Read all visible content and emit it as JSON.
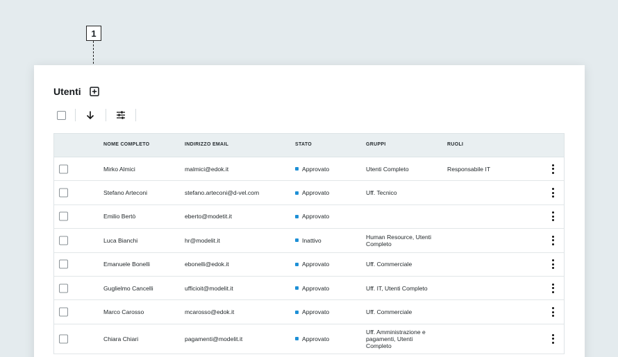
{
  "callout": {
    "label": "1"
  },
  "page": {
    "title": "Utenti"
  },
  "icons": {
    "add": "plus-square-icon",
    "sort": "arrow-down-icon",
    "filter": "sliders-icon",
    "row_menu": "more-vertical-icon"
  },
  "colors": {
    "status_dot": "#1e90d6",
    "header_bg": "#e9eff1"
  },
  "table": {
    "columns": [
      "NOME COMPLETO",
      "INDIRIZZO EMAIL",
      "STATO",
      "GRUPPI",
      "RUOLI"
    ],
    "rows": [
      {
        "name": "Mirko Almici",
        "email": "malmici@edok.it",
        "status": "Approvato",
        "groups": "Utenti Completo",
        "roles": "Responsabile IT"
      },
      {
        "name": "Stefano Arteconi",
        "email": "stefano.arteconi@d-vel.com",
        "status": "Approvato",
        "groups": "Uff. Tecnico",
        "roles": ""
      },
      {
        "name": "Emilio Bertò",
        "email": "eberto@modetit.it",
        "status": "Approvato",
        "groups": "",
        "roles": ""
      },
      {
        "name": "Luca Bianchi",
        "email": "hr@modelit.it",
        "status": "Inattivo",
        "groups": "Human Resource, Utenti Completo",
        "roles": ""
      },
      {
        "name": "Emanuele Bonelli",
        "email": "ebonelli@edok.it",
        "status": "Approvato",
        "groups": "Uff. Commerciale",
        "roles": ""
      },
      {
        "name": "Guglielmo Cancelli",
        "email": "ufficioit@modelit.it",
        "status": "Approvato",
        "groups": "Uff. IT, Utenti Completo",
        "roles": ""
      },
      {
        "name": "Marco Carosso",
        "email": "mcarosso@edok.it",
        "status": "Approvato",
        "groups": "Uff. Commerciale",
        "roles": ""
      },
      {
        "name": "Chiara Chiari",
        "email": "pagamenti@modelit.it",
        "status": "Approvato",
        "groups": "Uff. Amministrazione e pagamenti, Utenti Completo",
        "roles": ""
      }
    ]
  }
}
